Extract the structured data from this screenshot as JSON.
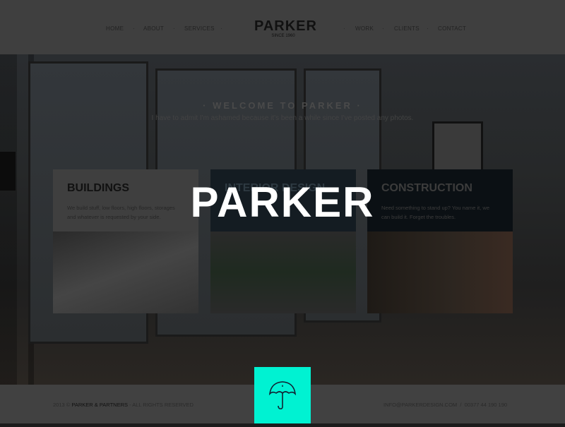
{
  "header": {
    "nav_left": [
      "HOME",
      "ABOUT",
      "SERVICES"
    ],
    "nav_right": [
      "WORK",
      "CLIENTS",
      "CONTACT"
    ],
    "logo": "PARKER",
    "since": "SINCE 1960"
  },
  "hero": {
    "welcome": "· WELCOME TO PARKER ·",
    "subtitle": "I have to admit I'm ashamed because it's been a while since I've posted any photos."
  },
  "cards": [
    {
      "title": "BUILDINGS",
      "text": "We build stuff, low floors, high floors, storages and whatever is requested by your side."
    },
    {
      "title": "INTERIOR DESIGN",
      "text": ""
    },
    {
      "title": "CONSTRUCTION",
      "text": "Need something to stand up? You name it, we can build it. Forget the troubles."
    }
  ],
  "overlay_logo": "PARKER",
  "footer": {
    "year": "2013 ©",
    "company": "PARKER & PARTNERS",
    "rights": "- ALL RIGHTS RESERVED",
    "email": "INFO@PARKERDESIGN.COM",
    "sep": "/",
    "phone": "00377 44 190 190",
    "icon": "umbrella-icon"
  },
  "colors": {
    "accent": "#00f2d2"
  }
}
